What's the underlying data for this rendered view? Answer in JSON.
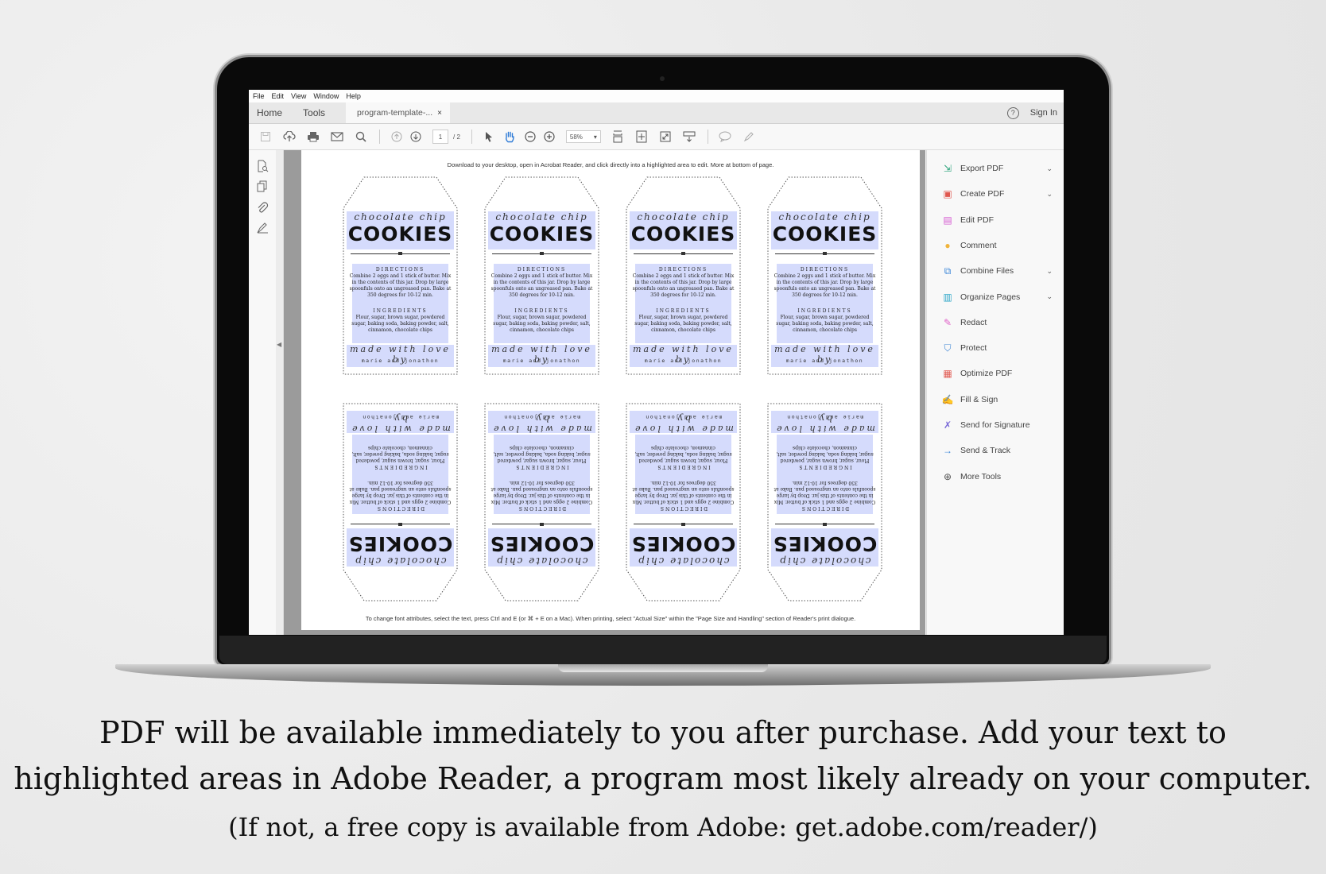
{
  "menu": [
    "File",
    "Edit",
    "View",
    "Window",
    "Help"
  ],
  "tabs": {
    "home": "Home",
    "tools": "Tools",
    "document": "program-template-...",
    "close": "×"
  },
  "header": {
    "help": "?",
    "sign_in": "Sign In"
  },
  "toolbar": {
    "icons": [
      "save-icon",
      "cloud-upload-icon",
      "print-icon",
      "email-icon",
      "search-icon",
      "page-up-icon",
      "page-down-icon"
    ],
    "page_current": "1",
    "page_total": "/ 2",
    "zoom": "58%",
    "zoom_caret": "▾"
  },
  "left_rail": [
    "document-search-icon",
    "pages-icon",
    "attachment-icon",
    "signature-icon"
  ],
  "document": {
    "top_note": "Download to your desktop, open in Acrobat Reader, and click directly into a highlighted area to edit. More at bottom of page.",
    "bottom_note": "To change font attributes, select the text, press Ctrl and E (or ⌘ + E on a Mac).  When printing, select \"Actual Size\" within the \"Page Size and Handling\" section of Reader's print dialogue.",
    "label": {
      "script": "chocolate chip",
      "title": "COOKIES",
      "directions_heading": "DIRECTIONS",
      "directions": "Combine 2 eggs and 1 stick of butter.  Mix in the contents of this jar.  Drop by large spoonfuls onto an ungreased pan.  Bake at 350 degrees for 10-12 min.",
      "ingredients_heading": "INGREDIENTS",
      "ingredients": "Flour, sugar, brown sugar, powdered sugar, baking soda, baking powder, salt, cinnamon, chocolate chips",
      "made_with": "made with love by",
      "names": "marie and jonathon"
    }
  },
  "tools_panel": [
    {
      "label": "Export PDF",
      "icon": "export-pdf-icon",
      "color": "#2aa37a",
      "expandable": true
    },
    {
      "label": "Create PDF",
      "icon": "create-pdf-icon",
      "color": "#e0574f",
      "expandable": true
    },
    {
      "label": "Edit PDF",
      "icon": "edit-pdf-icon",
      "color": "#d55bd1",
      "expandable": false
    },
    {
      "label": "Comment",
      "icon": "comment-icon",
      "color": "#f0b43c",
      "expandable": false
    },
    {
      "label": "Combine Files",
      "icon": "combine-files-icon",
      "color": "#3b86d8",
      "expandable": true
    },
    {
      "label": "Organize Pages",
      "icon": "organize-pages-icon",
      "color": "#31a8c9",
      "expandable": true
    },
    {
      "label": "Redact",
      "icon": "redact-icon",
      "color": "#e060c8",
      "expandable": false
    },
    {
      "label": "Protect",
      "icon": "protect-icon",
      "color": "#3f86d4",
      "expandable": false
    },
    {
      "label": "Optimize PDF",
      "icon": "optimize-pdf-icon",
      "color": "#e0574f",
      "expandable": false
    },
    {
      "label": "Fill & Sign",
      "icon": "fill-sign-icon",
      "color": "#7a6ad8",
      "expandable": false
    },
    {
      "label": "Send for Signature",
      "icon": "send-signature-icon",
      "color": "#7a6ad8",
      "expandable": false
    },
    {
      "label": "Send & Track",
      "icon": "send-track-icon",
      "color": "#3b86d8",
      "expandable": false
    },
    {
      "label": "More Tools",
      "icon": "more-tools-icon",
      "color": "#555555",
      "expandable": false
    }
  ],
  "caption": {
    "line1": "PDF will be available immediately to you after purchase.  Add your text to",
    "line2": "highlighted areas in Adobe Reader, a program most likely already on your computer.",
    "line3": "(If not, a free copy is available from Adobe: get.adobe.com/reader/)"
  }
}
